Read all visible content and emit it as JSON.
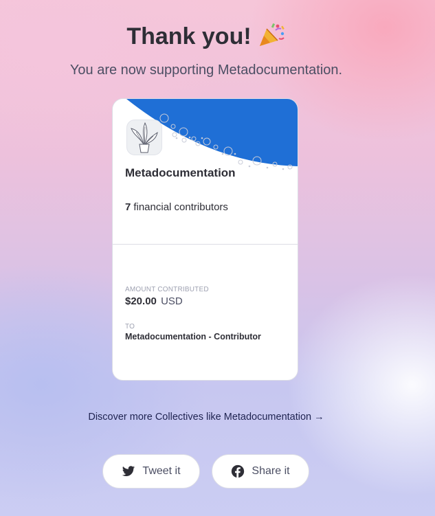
{
  "header": {
    "title": "Thank you!",
    "title_emoji": "party-popper-icon",
    "subtitle": "You are now supporting Metadocumentation."
  },
  "card": {
    "collective_name": "Metadocumentation",
    "avatar_icon": "potted-plant-icon",
    "contributors_count": "7",
    "contributors_label": "financial contributors",
    "amount_label": "AMOUNT CONTRIBUTED",
    "amount_value": "$20.00",
    "amount_currency": "USD",
    "to_label": "TO",
    "tier_name": "Metadocumentation - Contributor",
    "banner_color": "#1f6fd6"
  },
  "links": {
    "discover": "Discover more Collectives like Metadocumentation →"
  },
  "share": {
    "tweet_label": "Tweet it",
    "share_label": "Share it"
  },
  "colors": {
    "text_primary": "#2e2e36",
    "text_secondary": "#4b4e63",
    "muted_label": "#9ea1b1"
  }
}
